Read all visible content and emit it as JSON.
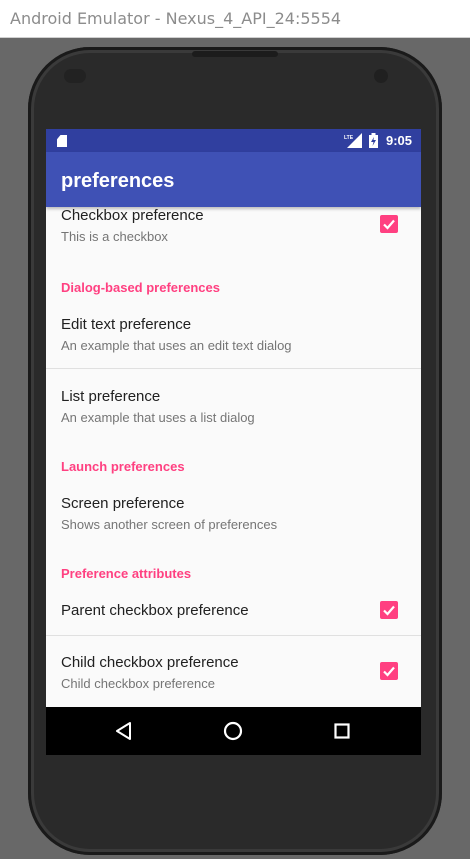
{
  "window": {
    "title": "Android Emulator - Nexus_4_API_24:5554"
  },
  "status_bar": {
    "time": "9:05",
    "network": "LTE",
    "icons": [
      "sd-card-icon",
      "signal-icon",
      "battery-icon"
    ]
  },
  "app_bar": {
    "title": "preferences"
  },
  "preferences": {
    "checkbox": {
      "title": "Checkbox preference",
      "summary": "This is a checkbox",
      "checked": true
    },
    "cat_dialog": "Dialog-based preferences",
    "edit_text": {
      "title": "Edit text preference",
      "summary": "An example that uses an edit text dialog"
    },
    "list": {
      "title": "List preference",
      "summary": "An example that uses a list dialog"
    },
    "cat_launch": "Launch preferences",
    "screen": {
      "title": "Screen preference",
      "summary": "Shows another screen of preferences"
    },
    "cat_attributes": "Preference attributes",
    "parent_checkbox": {
      "title": "Parent checkbox preference",
      "checked": true
    },
    "child_checkbox": {
      "title": "Child checkbox preference",
      "summary": "Child checkbox preference",
      "checked": true
    }
  },
  "nav_bar": {
    "buttons": [
      "back-icon",
      "home-icon",
      "recents-icon"
    ]
  },
  "colors": {
    "primary": "#3f51b5",
    "primary_dark": "#303f9f",
    "accent": "#ff4081"
  }
}
